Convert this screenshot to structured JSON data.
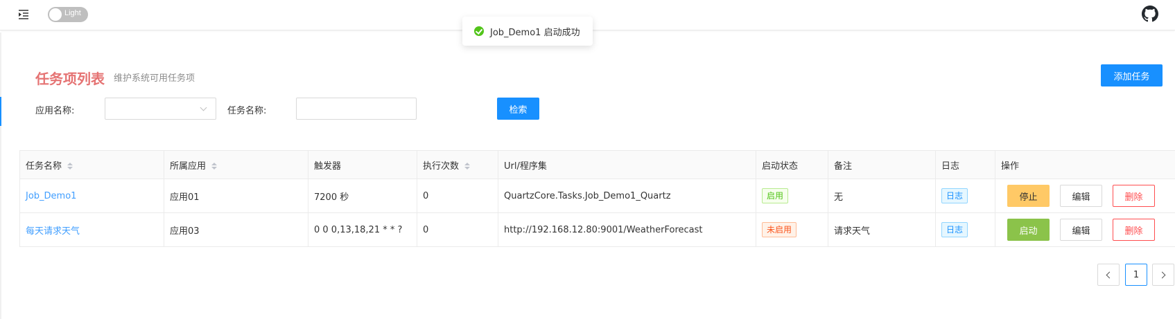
{
  "topbar": {
    "theme_label": "Light",
    "menu_icon": "menu-fold-icon",
    "github_icon": "github-icon"
  },
  "toast": {
    "message": "Job_Demo1 启动成功",
    "icon": "check-circle-icon",
    "status_color": "#52c41a"
  },
  "header": {
    "title": "任务项列表",
    "subtitle": "维护系统可用任务项",
    "add_button": "添加任务"
  },
  "filters": {
    "app_label": "应用名称:",
    "task_label": "任务名称:",
    "search_button": "检索",
    "app_value": "",
    "task_value": ""
  },
  "table": {
    "columns": [
      "任务名称",
      "所属应用",
      "触发器",
      "执行次数",
      "Url/程序集",
      "启动状态",
      "备注",
      "日志",
      "操作"
    ],
    "rows": [
      {
        "name": "Job_Demo1",
        "app": "应用01",
        "trigger": "7200 秒",
        "count": "0",
        "url": "QuartzCore.Tasks.Job_Demo1_Quartz",
        "status": "启用",
        "remark": "无",
        "log": "日志",
        "action": "停止",
        "edit": "编辑",
        "delete": "删除"
      },
      {
        "name": "每天请求天气",
        "app": "应用03",
        "trigger": "0 0 0,13,18,21 * * ?",
        "count": "0",
        "url": "http://192.168.12.80:9001/WeatherForecast",
        "status": "未启用",
        "remark": "请求天气",
        "log": "日志",
        "action": "启动",
        "edit": "编辑",
        "delete": "删除"
      }
    ]
  },
  "pagination": {
    "current": "1"
  },
  "colors": {
    "primary": "#1890ff",
    "title": "#e57373",
    "stop_button": "#ffc966",
    "start_button": "#8bc34a",
    "delete": "#ff4d4f"
  }
}
